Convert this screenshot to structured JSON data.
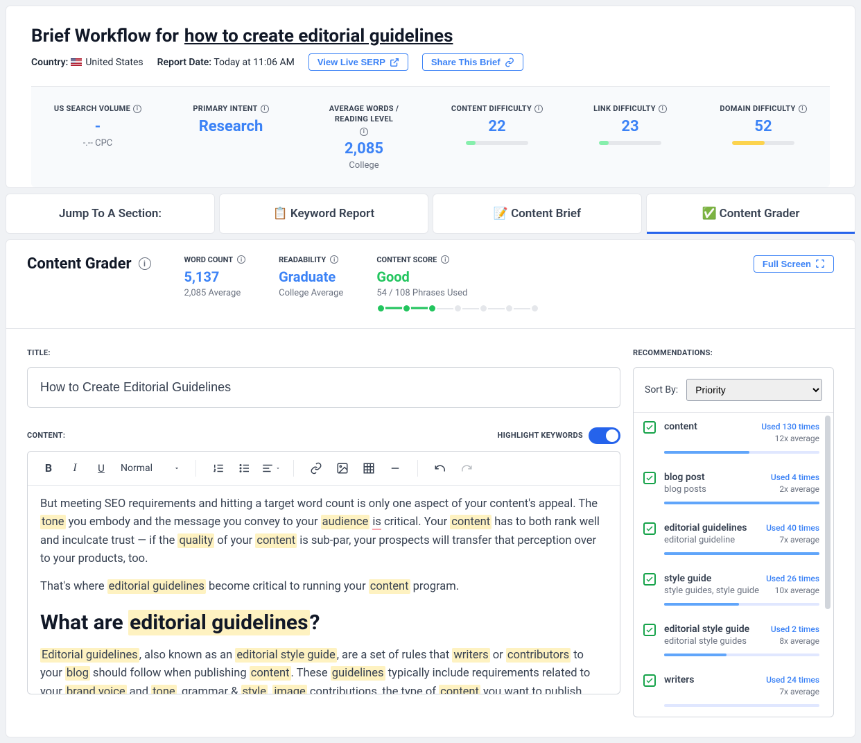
{
  "header": {
    "prefix": "Brief Workflow for",
    "keyword": "how to create editorial guidelines",
    "country_label": "Country:",
    "country_value": "United States",
    "report_label": "Report Date:",
    "report_value": "Today at 11:06 AM",
    "view_serp": "View Live SERP",
    "share": "Share This Brief"
  },
  "metrics": [
    {
      "label": "US SEARCH VOLUME",
      "value": "-",
      "sub": "-.-- CPC",
      "bar": null
    },
    {
      "label": "PRIMARY INTENT",
      "value": "Research",
      "sub": "",
      "bar": null
    },
    {
      "label": "AVERAGE WORDS / READING LEVEL",
      "value": "2,085",
      "sub": "College",
      "bar": null
    },
    {
      "label": "CONTENT DIFFICULTY",
      "value": "22",
      "sub": "",
      "bar": {
        "pct": 15,
        "color": "#86efac"
      }
    },
    {
      "label": "LINK DIFFICULTY",
      "value": "23",
      "sub": "",
      "bar": {
        "pct": 16,
        "color": "#86efac"
      }
    },
    {
      "label": "DOMAIN DIFFICULTY",
      "value": "52",
      "sub": "",
      "bar": {
        "pct": 52,
        "color": "#fcd34d"
      }
    }
  ],
  "tabs": {
    "label": "Jump To A Section:",
    "items": [
      {
        "emoji": "📋",
        "text": "Keyword Report",
        "active": false
      },
      {
        "emoji": "📝",
        "text": "Content Brief",
        "active": false
      },
      {
        "emoji": "✅",
        "text": "Content Grader",
        "active": true
      }
    ]
  },
  "grader": {
    "title": "Content Grader",
    "word_count": {
      "label": "WORD COUNT",
      "value": "5,137",
      "sub": "2,085 Average"
    },
    "readability": {
      "label": "READABILITY",
      "value": "Graduate",
      "sub": "College Average"
    },
    "score": {
      "label": "CONTENT SCORE",
      "value": "Good",
      "sub": "54 / 108 Phrases Used",
      "dots_on": 3,
      "dots_total": 7
    },
    "fullscreen": "Full Screen"
  },
  "editor": {
    "title_label": "TITLE:",
    "title_value": "How to Create Editorial Guidelines",
    "content_label": "CONTENT:",
    "highlight_label": "HIGHLIGHT KEYWORDS",
    "format_select": "Normal",
    "body_html": "But meeting SEO requirements and hitting a target word count is only one aspect of your content's appeal. The <span class='kw'>tone</span> you embody and the message you convey to your <span class='kw'>audience</span> <span class='sp'>is</span> critical. Your <span class='kw'>content</span> has to both rank well and inculcate trust — if the <span class='kw'>quality</span> of your <span class='kw'>content</span> is sub-par, your prospects will transfer that perception over to your products, too.",
    "body_p2": "That's where <span class='kw'>editorial guidelines</span> become critical to running your <span class='kw'>content</span> program.",
    "h1": "What are <span class='kw'>editorial guidelines</span>?",
    "body_p3": "<span class='kw'>Editorial guidelines</span>, also known as an <span class='kw'>editorial style guide</span>, are a set of rules that <span class='kw'>writers</span> or <span class='kw'>contributors</span> to your <span class='kw'>blog</span> should follow when publishing <span class='kw'>content</span>. These <span class='kw'>guidelines</span> typically include requirements related to your <span class='kw'>brand voice</span> and <span class='kw'>tone</span>, grammar & <span class='kw'>style</span>, <span class='kw'>image</span> contributions, the type of <span class='kw'>content</span> you want to publish, your <span class='kw'>audience</span>, and how your editorial process works."
  },
  "recs": {
    "label": "RECOMMENDATIONS:",
    "sort_label": "Sort By:",
    "sort_value": "Priority",
    "items": [
      {
        "name": "content",
        "sub": "",
        "used": "Used 130 times",
        "avg": "12x average",
        "pct": 55
      },
      {
        "name": "blog post",
        "sub": "blog posts",
        "used": "Used 4 times",
        "avg": "2x average",
        "pct": 100
      },
      {
        "name": "editorial guidelines",
        "sub": "editorial guideline",
        "used": "Used 40 times",
        "avg": "7x average",
        "pct": 100
      },
      {
        "name": "style guide",
        "sub": "style guides, style guide",
        "used": "Used 26 times",
        "avg": "10x average",
        "pct": 48
      },
      {
        "name": "editorial style guide",
        "sub": "editorial style guides",
        "used": "Used 2 times",
        "avg": "8x average",
        "pct": 40
      },
      {
        "name": "writers",
        "sub": "",
        "used": "Used 24 times",
        "avg": "7x average",
        "pct": 0
      }
    ]
  }
}
